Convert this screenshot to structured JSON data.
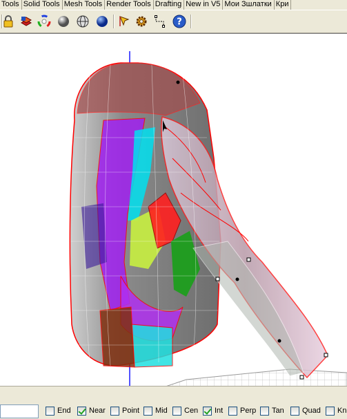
{
  "tabs": [
    "Tools",
    "Solid Tools",
    "Mesh Tools",
    "Render Tools",
    "Drafting",
    "New in V5",
    "Мои Зшлатки",
    "Кри"
  ],
  "toolbar": {
    "icons": [
      "lock-icon",
      "layer-icon",
      "color-wheel-icon",
      "sphere-shade-icon",
      "sphere-wire-icon",
      "sphere-render-icon",
      "cursor-arrow-icon",
      "gear-icon",
      "dimension-icon",
      "help-icon"
    ]
  },
  "osnaps": [
    {
      "label": "End",
      "checked": false
    },
    {
      "label": "Near",
      "checked": true
    },
    {
      "label": "Point",
      "checked": false
    },
    {
      "label": "Mid",
      "checked": false
    },
    {
      "label": "Cen",
      "checked": false
    },
    {
      "label": "Int",
      "checked": true
    },
    {
      "label": "Perp",
      "checked": false
    },
    {
      "label": "Tan",
      "checked": false
    },
    {
      "label": "Quad",
      "checked": false
    },
    {
      "label": "Kn",
      "checked": false
    }
  ],
  "colors": {
    "ui_bg": "#ece9d8",
    "viewport_bg": "#ffffff",
    "axis_blue": "#1a1aff",
    "edge_red": "#ff0000"
  }
}
